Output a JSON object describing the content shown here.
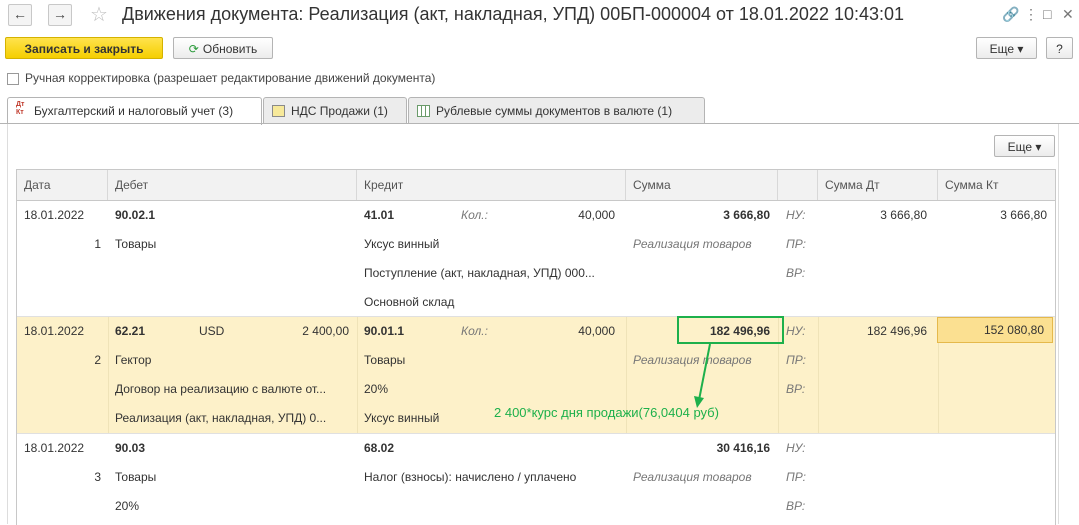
{
  "window": {
    "title": "Движения документа: Реализация (акт, накладная, УПД) 00БП-000004 от 18.01.2022 10:43:01",
    "back_icon": "←",
    "forward_icon": "→",
    "star_icon": "☆",
    "link_icon": "🔗",
    "menu_icon": "⋮",
    "maximize_icon": "□",
    "close_icon": "✕"
  },
  "toolbar": {
    "save_close_label": "Записать и закрыть",
    "refresh_label": "Обновить",
    "refresh_icon": "⟳",
    "more_label": "Еще ▾",
    "help_label": "?"
  },
  "manual_correction_label": "Ручная корректировка (разрешает редактирование движений документа)",
  "tabs": [
    {
      "label": "Бухгалтерский и налоговый учет (3)",
      "icon": "Дт Кт"
    },
    {
      "label": "НДС Продажи (1)"
    },
    {
      "label": "Рублевые суммы документов в валюте (1)"
    }
  ],
  "grid_more_label": "Еще ▾",
  "columns": {
    "date": "Дата",
    "debit": "Дебет",
    "credit": "Кредит",
    "sum": "Сумма",
    "sum_dt": "Сумма Дт",
    "sum_kt": "Сумма Кт"
  },
  "rows": [
    {
      "date": "18.01.2022",
      "num": "1",
      "debit_account": "90.02.1",
      "debit_currency": "",
      "debit_amount": "",
      "debit_sub": [
        "Товары",
        "",
        ""
      ],
      "credit_account": "41.01",
      "credit_qty_label": "Кол.:",
      "credit_qty": "40,000",
      "credit_sub": [
        "Уксус винный",
        "Поступление (акт, накладная, УПД) 000...",
        "Основной склад"
      ],
      "sum": "3 666,80",
      "content": "Реализация товаров",
      "nu": "НУ:",
      "pr": "ПР:",
      "vr": "ВР:",
      "sum_dt": "3 666,80",
      "sum_kt": "3 666,80"
    },
    {
      "date": "18.01.2022",
      "num": "2",
      "debit_account": "62.21",
      "debit_currency": "USD",
      "debit_amount": "2 400,00",
      "debit_sub": [
        "Гектор",
        "Договор на реализацию с валюте от...",
        "Реализация (акт, накладная, УПД) 0..."
      ],
      "credit_account": "90.01.1",
      "credit_qty_label": "Кол.:",
      "credit_qty": "40,000",
      "credit_sub": [
        "Товары",
        "20%",
        "Уксус винный"
      ],
      "sum": "182 496,96",
      "content": "Реализация товаров",
      "nu": "НУ:",
      "pr": "ПР:",
      "vr": "ВР:",
      "sum_dt": "182 496,96",
      "sum_kt": "152 080,80"
    },
    {
      "date": "18.01.2022",
      "num": "3",
      "debit_account": "90.03",
      "debit_currency": "",
      "debit_amount": "",
      "debit_sub": [
        "Товары",
        "20%",
        ""
      ],
      "credit_account": "68.02",
      "credit_qty_label": "",
      "credit_qty": "",
      "credit_sub": [
        "Налог (взносы): начислено / уплачено",
        "",
        ""
      ],
      "sum": "30 416,16",
      "content": "Реализация товаров",
      "nu": "НУ:",
      "pr": "ПР:",
      "vr": "ВР:",
      "sum_dt": "",
      "sum_kt": ""
    }
  ],
  "annotation": {
    "text": "2 400*курс дня продажи(76,0404 руб)",
    "color": "#1db04b"
  }
}
